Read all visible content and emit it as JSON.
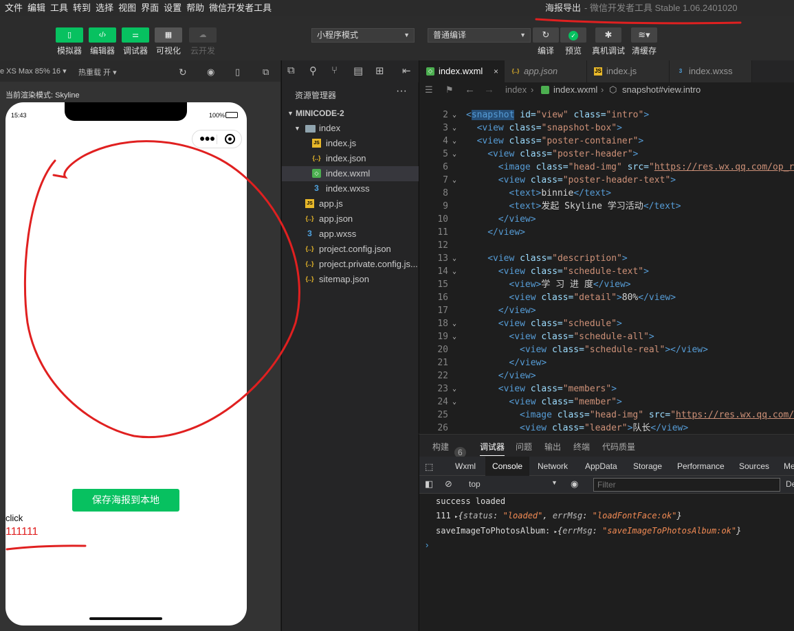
{
  "menu": [
    "文件",
    "编辑",
    "工具",
    "转到",
    "选择",
    "视图",
    "界面",
    "设置",
    "帮助",
    "微信开发者工具"
  ],
  "window_title": {
    "project": "海报导出",
    "app": "- 微信开发者工具 Stable 1.06.2401020"
  },
  "toolbar": {
    "simulator": "模拟器",
    "editor": "编辑器",
    "debugger": "调试器",
    "visual": "可视化",
    "cloud": "云开发",
    "mode_select": "小程序模式",
    "compile_select": "普通编译",
    "compile": "编译",
    "preview": "预览",
    "real_debug": "真机调试",
    "clear_cache": "清缓存"
  },
  "simbar": {
    "device": "e XS Max 85% 16 ▾",
    "hot_reload": "热重载 开 ▾"
  },
  "render_mode": "当前渲染模式: Skyline",
  "phone": {
    "time": "15:43",
    "battery": "100%",
    "save_button": "保存海报到本地",
    "click_text": "click",
    "number_text": "111111"
  },
  "explorer": {
    "title": "资源管理器",
    "project": "MINICODE-2",
    "files": [
      {
        "name": "index",
        "type": "folder",
        "level": 1
      },
      {
        "name": "index.js",
        "type": "js",
        "level": 2
      },
      {
        "name": "index.json",
        "type": "json",
        "level": 2
      },
      {
        "name": "index.wxml",
        "type": "wxml",
        "level": 2,
        "active": true
      },
      {
        "name": "index.wxss",
        "type": "wxss",
        "level": 2
      },
      {
        "name": "app.js",
        "type": "js",
        "level": 1
      },
      {
        "name": "app.json",
        "type": "json",
        "level": 1
      },
      {
        "name": "app.wxss",
        "type": "wxss",
        "level": 1
      },
      {
        "name": "project.config.json",
        "type": "json",
        "level": 1
      },
      {
        "name": "project.private.config.js...",
        "type": "json",
        "level": 1
      },
      {
        "name": "sitemap.json",
        "type": "json",
        "level": 1
      }
    ]
  },
  "editor": {
    "tabs": [
      {
        "name": "index.wxml",
        "type": "wxml",
        "active": true
      },
      {
        "name": "app.json",
        "type": "json"
      },
      {
        "name": "index.js",
        "type": "js"
      },
      {
        "name": "index.wxss",
        "type": "wxss"
      }
    ],
    "breadcrumb": [
      "index",
      "index.wxml",
      "snapshot#view.intro"
    ],
    "lines": [
      {
        "n": "2",
        "fold": true,
        "indent": 0,
        "parts": [
          [
            "tg",
            "<"
          ],
          [
            "tg hl",
            "snapshot"
          ],
          [
            "at",
            " id="
          ],
          [
            "st",
            "\"view\""
          ],
          [
            "at",
            " class="
          ],
          [
            "st",
            "\"intro\""
          ],
          [
            "tg",
            ">"
          ]
        ]
      },
      {
        "n": "3",
        "fold": true,
        "indent": 1,
        "parts": [
          [
            "tg",
            "<view"
          ],
          [
            "at",
            " class="
          ],
          [
            "st",
            "\"snapshot-box\""
          ],
          [
            "tg",
            ">"
          ]
        ]
      },
      {
        "n": "4",
        "fold": true,
        "indent": 1,
        "parts": [
          [
            "tg",
            "<view"
          ],
          [
            "at",
            " class="
          ],
          [
            "st",
            "\"poster-container\""
          ],
          [
            "tg",
            ">"
          ]
        ]
      },
      {
        "n": "5",
        "fold": true,
        "indent": 2,
        "parts": [
          [
            "tg",
            "<view"
          ],
          [
            "at",
            " class="
          ],
          [
            "st",
            "\"poster-header\""
          ],
          [
            "tg",
            ">"
          ]
        ]
      },
      {
        "n": "6",
        "fold": false,
        "indent": 3,
        "parts": [
          [
            "tg",
            "<image"
          ],
          [
            "at",
            " class="
          ],
          [
            "st",
            "\"head-img\""
          ],
          [
            "at",
            " src="
          ],
          [
            "st",
            "\""
          ],
          [
            "ur",
            "https://res.wx.qq.com/op_re"
          ]
        ]
      },
      {
        "n": "7",
        "fold": true,
        "indent": 3,
        "parts": [
          [
            "tg",
            "<view"
          ],
          [
            "at",
            " class="
          ],
          [
            "st",
            "\"poster-header-text\""
          ],
          [
            "tg",
            ">"
          ]
        ]
      },
      {
        "n": "8",
        "fold": false,
        "indent": 4,
        "parts": [
          [
            "tg",
            "<text>"
          ],
          [
            "pl",
            "binnie"
          ],
          [
            "tg",
            "</text>"
          ]
        ]
      },
      {
        "n": "9",
        "fold": false,
        "indent": 4,
        "parts": [
          [
            "tg",
            "<text>"
          ],
          [
            "pl",
            "发起 Skyline 学习活动"
          ],
          [
            "tg",
            "</text>"
          ]
        ]
      },
      {
        "n": "10",
        "fold": false,
        "indent": 3,
        "parts": [
          [
            "tg",
            "</view>"
          ]
        ]
      },
      {
        "n": "11",
        "fold": false,
        "indent": 2,
        "parts": [
          [
            "tg",
            "</view>"
          ]
        ]
      },
      {
        "n": "12",
        "fold": false,
        "indent": 0,
        "parts": []
      },
      {
        "n": "13",
        "fold": true,
        "indent": 2,
        "parts": [
          [
            "tg",
            "<view"
          ],
          [
            "at",
            " class="
          ],
          [
            "st",
            "\"description\""
          ],
          [
            "tg",
            ">"
          ]
        ]
      },
      {
        "n": "14",
        "fold": true,
        "indent": 3,
        "parts": [
          [
            "tg",
            "<view"
          ],
          [
            "at",
            " class="
          ],
          [
            "st",
            "\"schedule-text\""
          ],
          [
            "tg",
            ">"
          ]
        ]
      },
      {
        "n": "15",
        "fold": false,
        "indent": 4,
        "parts": [
          [
            "tg",
            "<view>"
          ],
          [
            "pl",
            "学 习 进 度"
          ],
          [
            "tg",
            "</view>"
          ]
        ]
      },
      {
        "n": "16",
        "fold": false,
        "indent": 4,
        "parts": [
          [
            "tg",
            "<view"
          ],
          [
            "at",
            " class="
          ],
          [
            "st",
            "\"detail\""
          ],
          [
            "tg",
            ">"
          ],
          [
            "pl",
            "80%"
          ],
          [
            "tg",
            "</view>"
          ]
        ]
      },
      {
        "n": "17",
        "fold": false,
        "indent": 3,
        "parts": [
          [
            "tg",
            "</view>"
          ]
        ]
      },
      {
        "n": "18",
        "fold": true,
        "indent": 3,
        "parts": [
          [
            "tg",
            "<view"
          ],
          [
            "at",
            " class="
          ],
          [
            "st",
            "\"schedule\""
          ],
          [
            "tg",
            ">"
          ]
        ]
      },
      {
        "n": "19",
        "fold": true,
        "indent": 4,
        "parts": [
          [
            "tg",
            "<view"
          ],
          [
            "at",
            " class="
          ],
          [
            "st",
            "\"schedule-all\""
          ],
          [
            "tg",
            ">"
          ]
        ]
      },
      {
        "n": "20",
        "fold": false,
        "indent": 5,
        "parts": [
          [
            "tg",
            "<view"
          ],
          [
            "at",
            " class="
          ],
          [
            "st",
            "\"schedule-real\""
          ],
          [
            "tg",
            "></view>"
          ]
        ]
      },
      {
        "n": "21",
        "fold": false,
        "indent": 4,
        "parts": [
          [
            "tg",
            "</view>"
          ]
        ]
      },
      {
        "n": "22",
        "fold": false,
        "indent": 3,
        "parts": [
          [
            "tg",
            "</view>"
          ]
        ]
      },
      {
        "n": "23",
        "fold": true,
        "indent": 3,
        "parts": [
          [
            "tg",
            "<view"
          ],
          [
            "at",
            " class="
          ],
          [
            "st",
            "\"members\""
          ],
          [
            "tg",
            ">"
          ]
        ]
      },
      {
        "n": "24",
        "fold": true,
        "indent": 4,
        "parts": [
          [
            "tg",
            "<view"
          ],
          [
            "at",
            " class="
          ],
          [
            "st",
            "\"member\""
          ],
          [
            "tg",
            ">"
          ]
        ]
      },
      {
        "n": "25",
        "fold": false,
        "indent": 5,
        "parts": [
          [
            "tg",
            "<image"
          ],
          [
            "at",
            " class="
          ],
          [
            "st",
            "\"head-img\""
          ],
          [
            "at",
            " src="
          ],
          [
            "st",
            "\""
          ],
          [
            "ur",
            "https://res.wx.qq.com/o"
          ]
        ]
      },
      {
        "n": "26",
        "fold": false,
        "indent": 5,
        "parts": [
          [
            "tg",
            "<view"
          ],
          [
            "at",
            " class="
          ],
          [
            "st",
            "\"leader\""
          ],
          [
            "tg",
            ">"
          ],
          [
            "pl",
            "队长"
          ],
          [
            "tg",
            "</view>"
          ]
        ]
      }
    ]
  },
  "bottom": {
    "tabs": [
      "构建",
      "调试器",
      "问题",
      "输出",
      "终端",
      "代码质量"
    ],
    "build_count": "6",
    "devtools_tabs": [
      "Wxml",
      "Console",
      "Network",
      "AppData",
      "Storage",
      "Performance",
      "Sources",
      "Me"
    ],
    "context": "top",
    "filter_placeholder": "Filter",
    "default_levels": "De",
    "console": [
      {
        "label": "success loaded",
        "obj": []
      },
      {
        "label": "111",
        "obj": [
          [
            "status",
            "\"loaded\""
          ],
          [
            "errMsg",
            "\"loadFontFace:ok\""
          ]
        ]
      },
      {
        "label": "saveImageToPhotosAlbum:",
        "obj": [
          [
            "errMsg",
            "\"saveImageToPhotosAlbum:ok\""
          ]
        ]
      }
    ],
    "prompt": "›"
  },
  "colors": {
    "accent_green": "#07c160",
    "annotation_red": "#e02020"
  }
}
